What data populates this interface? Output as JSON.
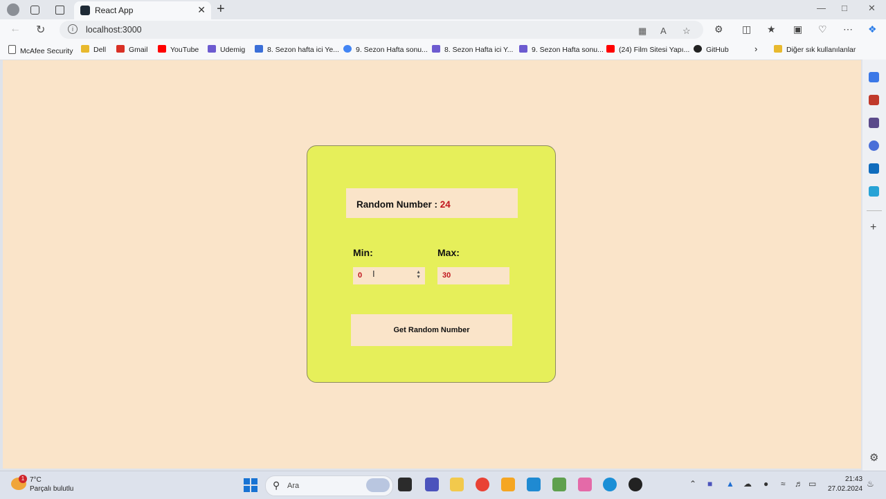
{
  "browser": {
    "tab_title": "React App",
    "tab_close": "✕",
    "new_tab": "+",
    "url": "localhost:3000"
  },
  "bookmarks": [
    {
      "label": "McAfee Security",
      "color": "#555555"
    },
    {
      "label": "Dell",
      "color": "#e8b92e"
    },
    {
      "label": "Gmail",
      "color": "#d93025"
    },
    {
      "label": "YouTube",
      "color": "#ff0000"
    },
    {
      "label": "Udemig",
      "color": "#6d5bd0"
    },
    {
      "label": "8. Sezon hafta ici Ye...",
      "color": "#3b6fd8"
    },
    {
      "label": "9. Sezon Hafta sonu...",
      "color": "#4285f4"
    },
    {
      "label": "8. Sezon Hafta ici Y...",
      "color": "#6d5bd0"
    },
    {
      "label": "9. Sezon Hafta sonu...",
      "color": "#6d5bd0"
    },
    {
      "label": "(24) Film Sitesi Yapı...",
      "color": "#ff0000"
    },
    {
      "label": "GitHub",
      "color": "#222222"
    }
  ],
  "bookmarks_more": "Diğer sık kullanılanlar",
  "app": {
    "result_label": "Random Number : ",
    "result_value": "24",
    "min_label": "Min:",
    "max_label": "Max:",
    "min_value": "0",
    "max_value": "30",
    "button_label": "Get Random Number"
  },
  "colors": {
    "page_bg": "#fae4c9",
    "card_bg": "#e6ef5a",
    "accent_red": "#c0141c"
  },
  "taskbar": {
    "temperature": "7°C",
    "weather": "Parçalı bulutlu",
    "weather_badge": "1",
    "search_placeholder": "Ara",
    "time": "21:43",
    "date": "27.02.2024"
  }
}
